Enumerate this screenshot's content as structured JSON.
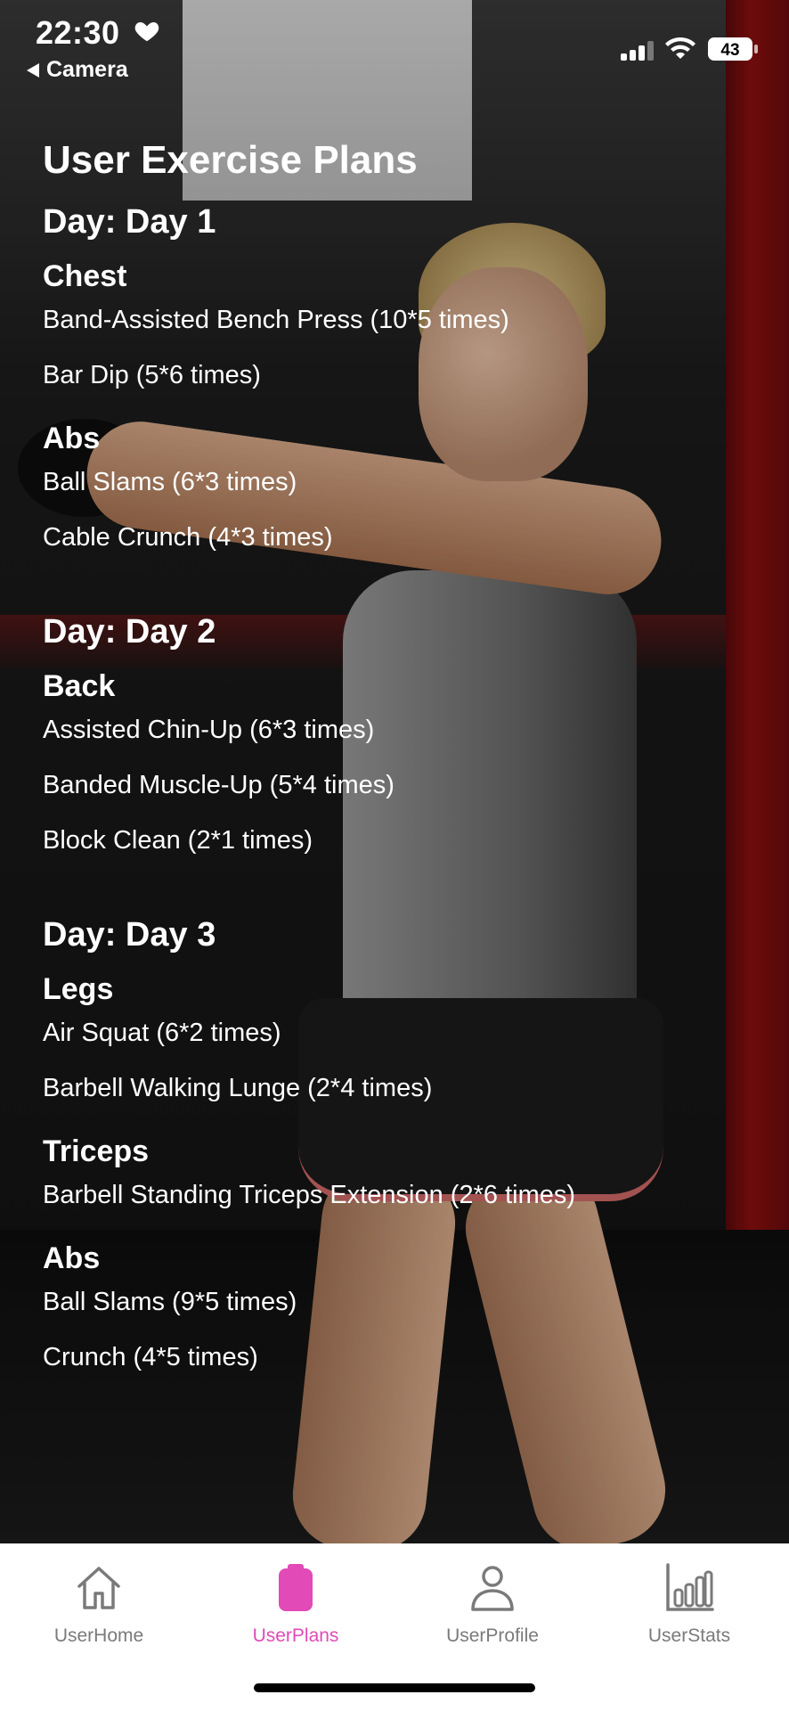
{
  "status": {
    "time": "22:30",
    "back_label": "Camera",
    "battery": "43"
  },
  "page": {
    "title": "User Exercise Plans"
  },
  "days": [
    {
      "title": "Day: Day 1",
      "groups": [
        {
          "name": "Chest",
          "exercises": [
            "Band-Assisted Bench Press (10*5 times)",
            "Bar Dip (5*6 times)"
          ]
        },
        {
          "name": "Abs",
          "exercises": [
            "Ball Slams (6*3 times)",
            "Cable Crunch (4*3 times)"
          ]
        }
      ]
    },
    {
      "title": "Day: Day 2",
      "groups": [
        {
          "name": "Back",
          "exercises": [
            "Assisted Chin-Up (6*3 times)",
            "Banded Muscle-Up (5*4 times)",
            "Block Clean (2*1 times)"
          ]
        }
      ]
    },
    {
      "title": "Day: Day 3",
      "groups": [
        {
          "name": "Legs",
          "exercises": [
            "Air Squat (6*2 times)",
            "Barbell Walking Lunge (2*4 times)"
          ]
        },
        {
          "name": "Triceps",
          "exercises": [
            "Barbell Standing Triceps Extension (2*6 times)"
          ]
        },
        {
          "name": "Abs",
          "exercises": [
            "Ball Slams (9*5 times)",
            "Crunch (4*5 times)"
          ]
        }
      ]
    }
  ],
  "tabs": [
    {
      "label": "UserHome",
      "icon": "home-icon"
    },
    {
      "label": "UserPlans",
      "icon": "clipboard-icon"
    },
    {
      "label": "UserProfile",
      "icon": "person-icon"
    },
    {
      "label": "UserStats",
      "icon": "bar-chart-icon"
    }
  ],
  "colors": {
    "accent": "#e14ab7",
    "inactive": "#7a7a7a",
    "text": "#ffffff"
  }
}
